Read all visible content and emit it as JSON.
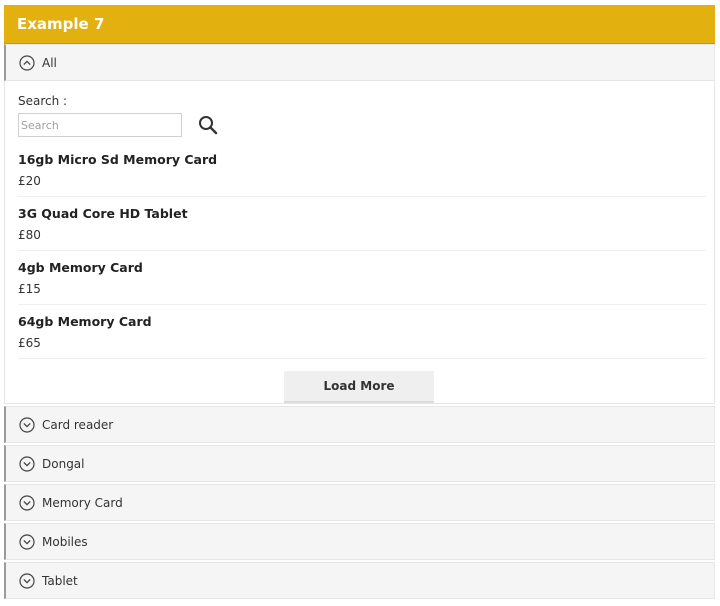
{
  "header": {
    "title": "Example 7"
  },
  "active_category": {
    "label": "All",
    "icon": "chevron-up-circle-icon"
  },
  "search": {
    "label": "Search :",
    "placeholder": "Search",
    "value": "",
    "button_icon": "search-icon"
  },
  "products": [
    {
      "name": "16gb Micro Sd Memory Card",
      "price": "£20"
    },
    {
      "name": "3G Quad Core HD Tablet",
      "price": "£80"
    },
    {
      "name": "4gb Memory Card",
      "price": "£15"
    },
    {
      "name": "64gb Memory Card",
      "price": "£65"
    }
  ],
  "load_more_label": "Load More",
  "categories": [
    {
      "label": "Card reader",
      "icon": "chevron-down-circle-icon"
    },
    {
      "label": "Dongal",
      "icon": "chevron-down-circle-icon"
    },
    {
      "label": "Memory Card",
      "icon": "chevron-down-circle-icon"
    },
    {
      "label": "Mobiles",
      "icon": "chevron-down-circle-icon"
    },
    {
      "label": "Tablet",
      "icon": "chevron-down-circle-icon"
    }
  ],
  "colors": {
    "header": "#e2b00f",
    "header_text": "#ffffff",
    "accordion_bg": "#f5f5f5"
  }
}
